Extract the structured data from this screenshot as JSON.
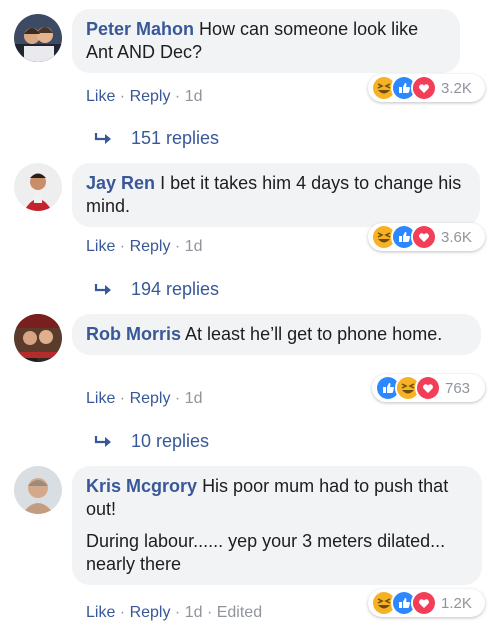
{
  "colors": {
    "link": "#385898",
    "meta": "#90949c",
    "bubble": "#f2f3f5",
    "like": "#2d88ff",
    "love": "#f33e58",
    "haha": "#f7b125"
  },
  "comments": [
    {
      "author": "Peter Mahon",
      "text": [
        "How can someone look like Ant AND Dec?"
      ],
      "like": "Like",
      "reply": "Reply",
      "time": "1d",
      "reactions": [
        "haha-icon",
        "like-icon",
        "love-icon"
      ],
      "reaction_count": "3.2K",
      "replies": "151 replies"
    },
    {
      "author": "Jay Ren",
      "text": [
        "I bet it takes him 4 days to change his mind."
      ],
      "like": "Like",
      "reply": "Reply",
      "time": "1d",
      "reactions": [
        "haha-icon",
        "like-icon",
        "love-icon"
      ],
      "reaction_count": "3.6K",
      "replies": "194 replies"
    },
    {
      "author": "Rob Morris",
      "text": [
        "At least he’ll get to phone home."
      ],
      "like": "Like",
      "reply": "Reply",
      "time": "1d",
      "reactions": [
        "like-icon",
        "haha-icon",
        "love-icon"
      ],
      "reaction_count": "763",
      "replies": "10 replies"
    },
    {
      "author": "Kris Mcgrory",
      "text": [
        "His poor mum had to push that out!",
        "During labour...... yep your 3 meters dilated... nearly there"
      ],
      "like": "Like",
      "reply": "Reply",
      "time": "1d",
      "edited": "Edited",
      "reactions": [
        "haha-icon",
        "like-icon",
        "love-icon"
      ],
      "reaction_count": "1.2K"
    }
  ]
}
